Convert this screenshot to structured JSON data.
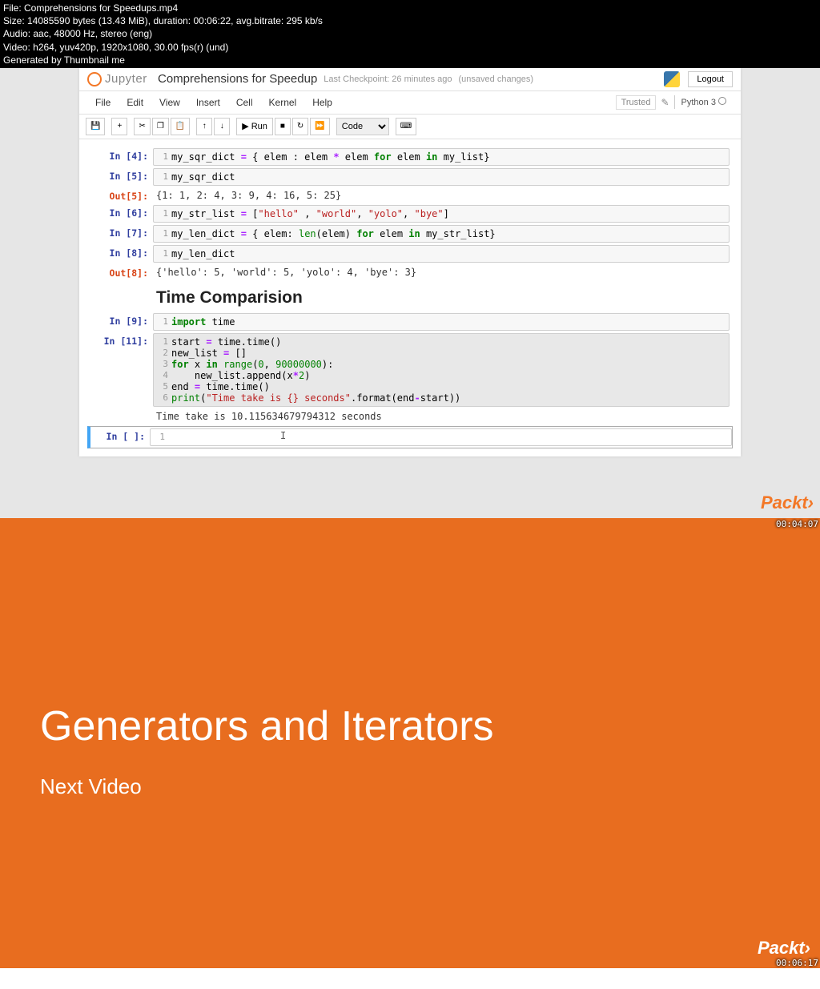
{
  "meta": {
    "file": "File: Comprehensions for Speedups.mp4",
    "size": "Size: 14085590 bytes (13.43 MiB), duration: 00:06:22, avg.bitrate: 295 kb/s",
    "audio": "Audio: aac, 48000 Hz, stereo (eng)",
    "video": "Video: h264, yuv420p, 1920x1080, 30.00 fps(r) (und)",
    "generated": "Generated by Thumbnail me"
  },
  "header": {
    "logo_text": "Jupyter",
    "title": "Comprehensions for Speedup",
    "checkpoint": "Last Checkpoint: 26 minutes ago",
    "unsaved": "(unsaved changes)",
    "logout": "Logout"
  },
  "menubar": [
    "File",
    "Edit",
    "View",
    "Insert",
    "Cell",
    "Kernel",
    "Help"
  ],
  "menubar_right": {
    "trusted": "Trusted",
    "kernel": "Python 3"
  },
  "toolbar": {
    "run": "Run",
    "celltype": "Code"
  },
  "cells": {
    "c4_prompt": "In [4]:",
    "c4_ln": "1",
    "c5_prompt": "In [5]:",
    "c5_ln": "1",
    "c5_code": "my_sqr_dict",
    "c5_out_prompt": "Out[5]:",
    "c5_out": "{1: 1, 2: 4, 3: 9, 4: 16, 5: 25}",
    "c6_prompt": "In [6]:",
    "c6_ln": "1",
    "c7_prompt": "In [7]:",
    "c7_ln": "1",
    "c8_prompt": "In [8]:",
    "c8_ln": "1",
    "c8_code": "my_len_dict",
    "c8_out_prompt": "Out[8]:",
    "c8_out": "{'hello': 5, 'world': 5, 'yolo': 4, 'bye': 3}",
    "md_heading": "Time Comparision",
    "c9_prompt": "In [9]:",
    "c9_ln": "1",
    "c11_prompt": "In [11]:",
    "c11_out": "Time take is 10.115634679794312 seconds",
    "cempty_prompt": "In [ ]:",
    "cempty_ln": "1"
  },
  "timestamps": {
    "top": "00:04:07",
    "bottom": "00:06:17"
  },
  "next_section": {
    "title": "Generators and Iterators",
    "label": "Next Video"
  },
  "packt": "Packt›"
}
